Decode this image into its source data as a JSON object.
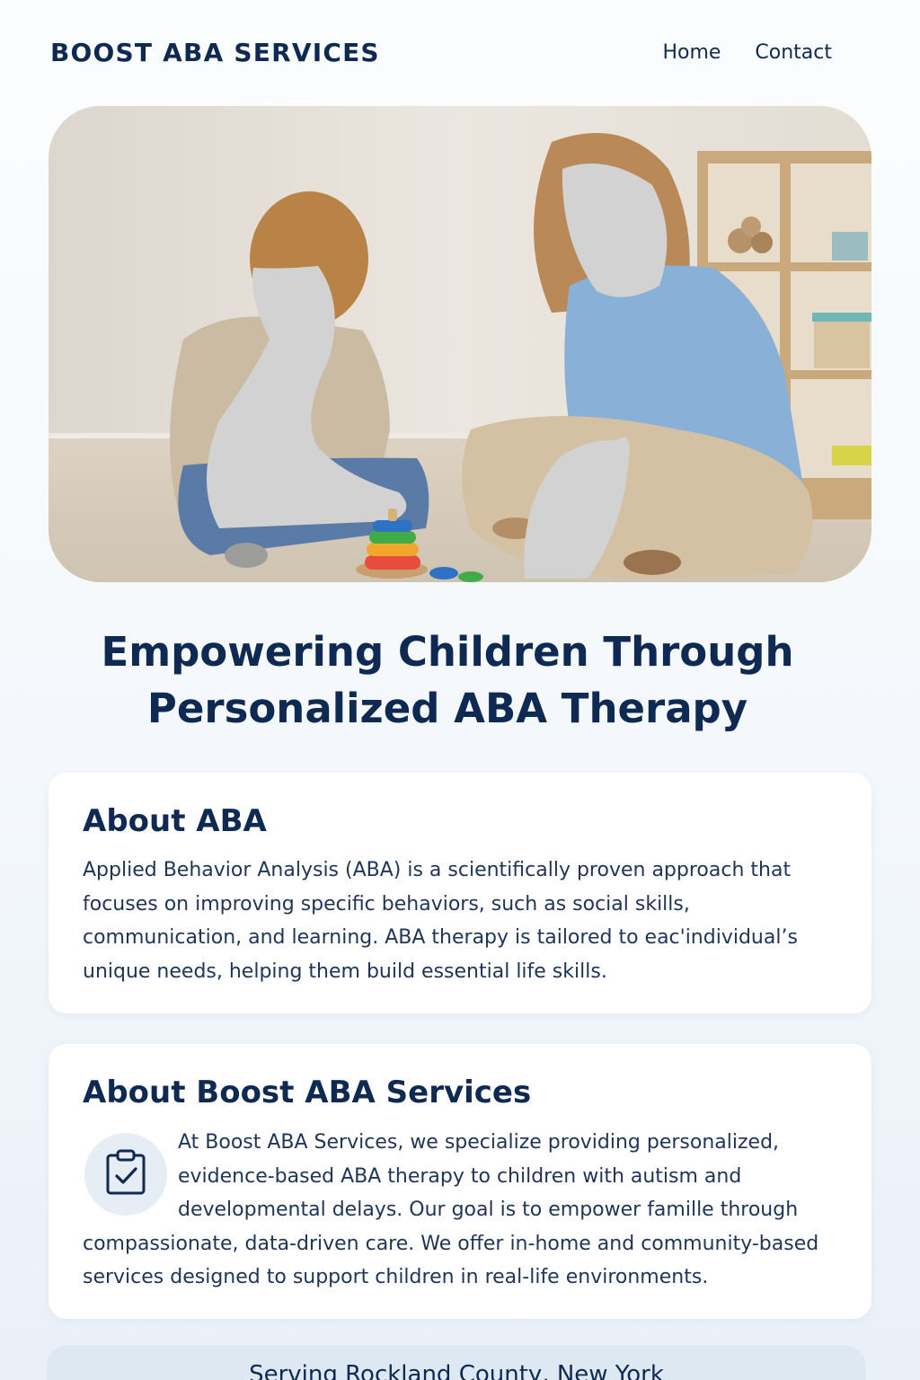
{
  "header": {
    "brand": "BOOST ABA SERVICES",
    "nav": [
      "Home",
      "Contact"
    ]
  },
  "hero": {
    "image": "child-and-therapist-playing-with-stacking-rings"
  },
  "headline": "Empowering Children Through Personalized ABA Therapy",
  "about_aba": {
    "title": "About ABA",
    "body": "Applied Behavior Analysis (ABA) is a scientifically proven approach that focuses on improving specific behaviors, such as social skills, communication, and learning. ABA therapy is tailored to eac'individual’s unique needs, helping them build essential life skills."
  },
  "about_boost": {
    "title": "About Boost ABA Services",
    "icon": "clipboard-check-icon",
    "body": "At Boost ABA Services, we specialize providing personalized, evidence-based ABA therapy to children with autism and developmental delays. Our goal is to empower famille through compassionate, data-driven care. We offer in-home and community-based services designed to support children in real-life environments."
  },
  "footer": {
    "location": "Serving Rockland County, New York"
  },
  "colors": {
    "navy": "#0f2a52",
    "card": "#ffffff",
    "footer_bar": "#dde8f2",
    "icon_bg": "#e6edf4"
  }
}
